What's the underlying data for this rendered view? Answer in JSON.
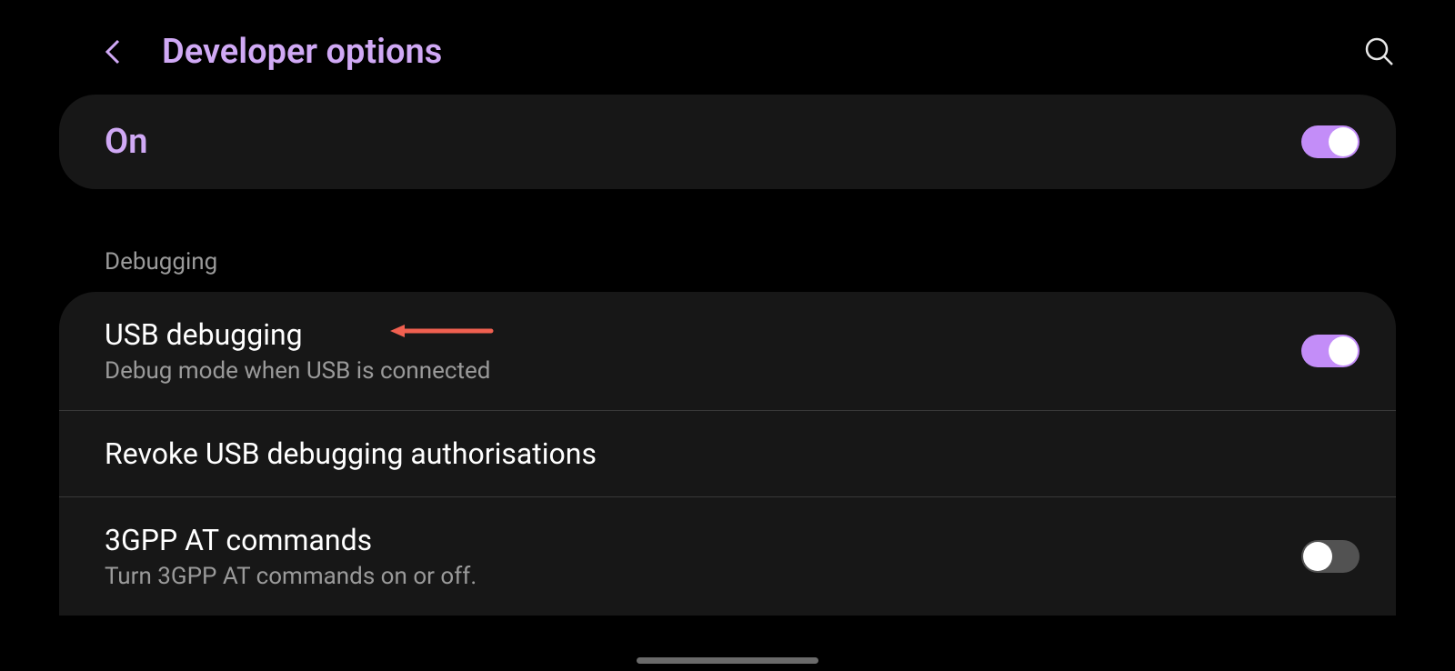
{
  "header": {
    "title": "Developer options"
  },
  "mainToggle": {
    "label": "On",
    "state": "on"
  },
  "sectionHeader": "Debugging",
  "settings": [
    {
      "title": "USB debugging",
      "description": "Debug mode when USB is connected",
      "toggle": "on",
      "hasArrowAnnotation": true
    },
    {
      "title": "Revoke USB debugging authorisations",
      "description": "",
      "toggle": null
    },
    {
      "title": "3GPP AT commands",
      "description": "Turn 3GPP AT commands on or off.",
      "toggle": "off"
    }
  ]
}
